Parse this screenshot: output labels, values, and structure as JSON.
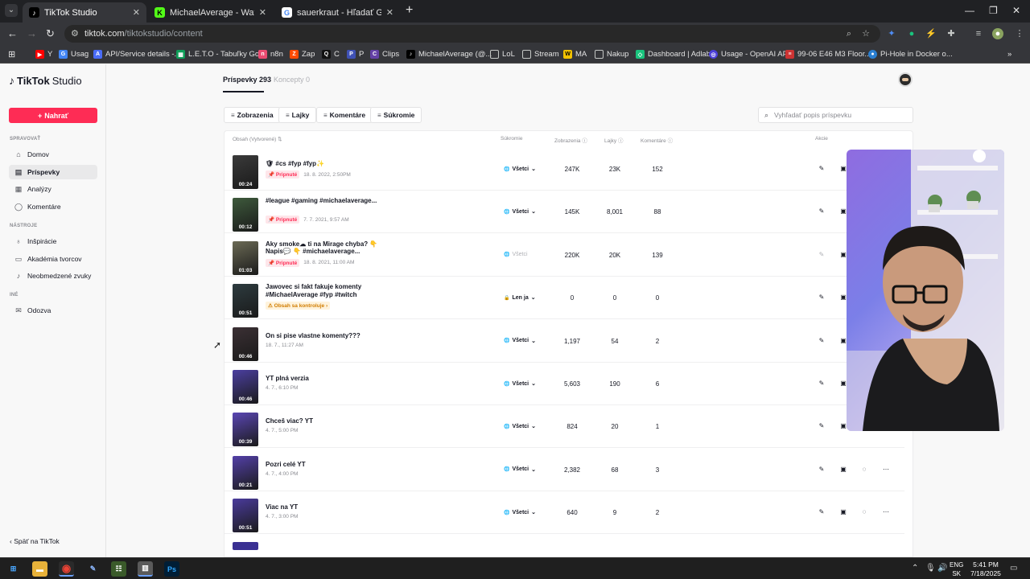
{
  "browser": {
    "tabs": [
      {
        "title": "TikTok Studio",
        "fav_color": "#000000",
        "fav": "♪",
        "active": true
      },
      {
        "title": "MichaelAverage - Watch the VO",
        "fav_color": "#53fc18",
        "fav": "K",
        "active": false
      },
      {
        "title": "sauerkraut - Hľadať Googlom",
        "fav_color": "#4285f4",
        "fav": "G",
        "active": false
      }
    ],
    "url_host": "tiktok.com",
    "url_path": "/tiktokstudio/content",
    "bookmarks": [
      {
        "label": "Y",
        "color": "#ff0000",
        "fav": "▶"
      },
      {
        "label": "Usag",
        "color": "#4285f4",
        "fav": "G"
      },
      {
        "label": "API/Service details -...",
        "color": "#4a6cf7",
        "fav": "A"
      },
      {
        "label": "L.E.T.O - Tabuľky Go...",
        "color": "#0f9d58",
        "fav": "▦"
      },
      {
        "label": "n8n",
        "color": "#ea4b71",
        "fav": "n"
      },
      {
        "label": "Zap",
        "color": "#ff4a00",
        "fav": "Z"
      },
      {
        "label": "C",
        "color": "#111111",
        "fav": "Q"
      },
      {
        "label": "P",
        "color": "#3f51b5",
        "fav": "P"
      },
      {
        "label": "Clips",
        "color": "#6441a5",
        "fav": "C"
      },
      {
        "label": "MichaelAverage (@...",
        "color": "#000000",
        "fav": "♪"
      },
      {
        "label": "LoL",
        "color": "#555555",
        "fav": "▭"
      },
      {
        "label": "Stream",
        "color": "#555555",
        "fav": "▭"
      },
      {
        "label": "MA",
        "color": "#f2c200",
        "fav": "W"
      },
      {
        "label": "Nakup",
        "color": "#555555",
        "fav": "▭"
      },
      {
        "label": "Dashboard | Adlab",
        "color": "#19c37d",
        "fav": "◇"
      },
      {
        "label": "Usage - OpenAI API",
        "color": "#4b3fd8",
        "fav": "◎"
      },
      {
        "label": "99-06 E46 M3 Floor...",
        "color": "#cc3333",
        "fav": "≡"
      },
      {
        "label": "Pi-Hole in Docker o...",
        "color": "#2a7fd1",
        "fav": "●"
      }
    ]
  },
  "sidebar": {
    "logo_tt": "TikTok",
    "logo_studio": "Studio",
    "upload_label": "Nahrať",
    "sections": {
      "manage": "SPRAVOVAŤ",
      "tools": "NÁSTROJE",
      "other": "INÉ"
    },
    "items": [
      {
        "label": "Domov",
        "icon": "home-icon"
      },
      {
        "label": "Príspevky",
        "icon": "posts-icon"
      },
      {
        "label": "Analýzy",
        "icon": "analytics-icon"
      },
      {
        "label": "Komentáre",
        "icon": "comments-icon"
      },
      {
        "label": "Inšpirácie",
        "icon": "lightbulb-icon"
      },
      {
        "label": "Akadémia tvorcov",
        "icon": "academy-icon"
      },
      {
        "label": "Neobmedzené zvuky",
        "icon": "music-icon"
      },
      {
        "label": "Odozva",
        "icon": "feedback-icon"
      }
    ],
    "back": "Späť na TikTok"
  },
  "content": {
    "tab_posts": "Príspevky 293",
    "tab_drafts": "Koncepty 0",
    "filters": [
      "Zobrazenia",
      "Lajky",
      "Komentáre",
      "Súkromie"
    ],
    "search_placeholder": "Vyhľadať popis príspevku",
    "headers": {
      "content": "Obsah (Vytvorené)",
      "privacy": "Súkromie",
      "views": "Zobrazenia",
      "likes": "Lajky",
      "comments": "Komentáre",
      "actions": "Akcie"
    },
    "pinned_label": "Pripnuté",
    "review_label": "Obsah sa kontroluje",
    "posts": [
      {
        "title": "🛡 #cs #fyp #fyp✨",
        "date": "18. 8. 2022, 2:50PM",
        "badge": "pinned",
        "privacy": "Všetci",
        "privacy_icon": "globe",
        "views": "247K",
        "likes": "23K",
        "comments": "152",
        "duration": "00:24",
        "thumb": "#3a3a3a"
      },
      {
        "title": "#league #gaming #michaelaverage...",
        "date": "7. 7. 2021, 9:57 AM",
        "badge": "pinned",
        "privacy": "Všetci",
        "privacy_icon": "globe",
        "views": "145K",
        "likes": "8,001",
        "comments": "88",
        "duration": "00:12",
        "thumb": "#3e5a3c"
      },
      {
        "title": "Aky smoke☁ ti na Mirage chyba? 👇 Napis💬 👇 #michaelaverage...",
        "date": "18. 8. 2021, 11:00 AM",
        "badge": "pinned",
        "privacy": "Všetci",
        "privacy_icon": "globe",
        "privacy_disabled": true,
        "views": "220K",
        "likes": "20K",
        "comments": "139",
        "duration": "01:03",
        "thumb": "#6b6a55"
      },
      {
        "title": "Jawovec si fakt fakuje komenty #MichaelAverage #fyp #twitch",
        "date": "",
        "badge": "review",
        "privacy": "Len ja",
        "privacy_icon": "lock",
        "views": "0",
        "likes": "0",
        "comments": "0",
        "duration": "00:51",
        "thumb": "#2d3b3f"
      },
      {
        "title": "On si pise vlastne komenty???",
        "date": "18. 7., 11:27 AM",
        "badge": "",
        "privacy": "Všetci",
        "privacy_icon": "globe",
        "views": "1,197",
        "likes": "54",
        "comments": "2",
        "duration": "00:46",
        "thumb": "#3b3034"
      },
      {
        "title": "YT plná verzia",
        "date": "4. 7., 6:10 PM",
        "badge": "",
        "privacy": "Všetci",
        "privacy_icon": "globe",
        "views": "5,603",
        "likes": "190",
        "comments": "6",
        "duration": "00:46",
        "thumb": "#4b3fa0"
      },
      {
        "title": "Chceš viac? YT",
        "date": "4. 7., 5:00 PM",
        "badge": "",
        "privacy": "Všetci",
        "privacy_icon": "globe",
        "views": "824",
        "likes": "20",
        "comments": "1",
        "duration": "00:39",
        "thumb": "#5a46b4"
      },
      {
        "title": "Pozri celé YT",
        "date": "4. 7., 4:00 PM",
        "badge": "",
        "privacy": "Všetci",
        "privacy_icon": "globe",
        "views": "2,382",
        "likes": "68",
        "comments": "3",
        "duration": "00:21",
        "thumb": "#5340a8"
      },
      {
        "title": "Viac na YT",
        "date": "4. 7., 3:00 PM",
        "badge": "",
        "privacy": "Všetci",
        "privacy_icon": "globe",
        "views": "640",
        "likes": "9",
        "comments": "2",
        "duration": "00:51",
        "thumb": "#4a3b9c"
      }
    ]
  },
  "taskbar": {
    "lang_top": "ENG",
    "lang_bottom": "SK",
    "time": "5:41 PM",
    "date": "7/18/2025"
  }
}
